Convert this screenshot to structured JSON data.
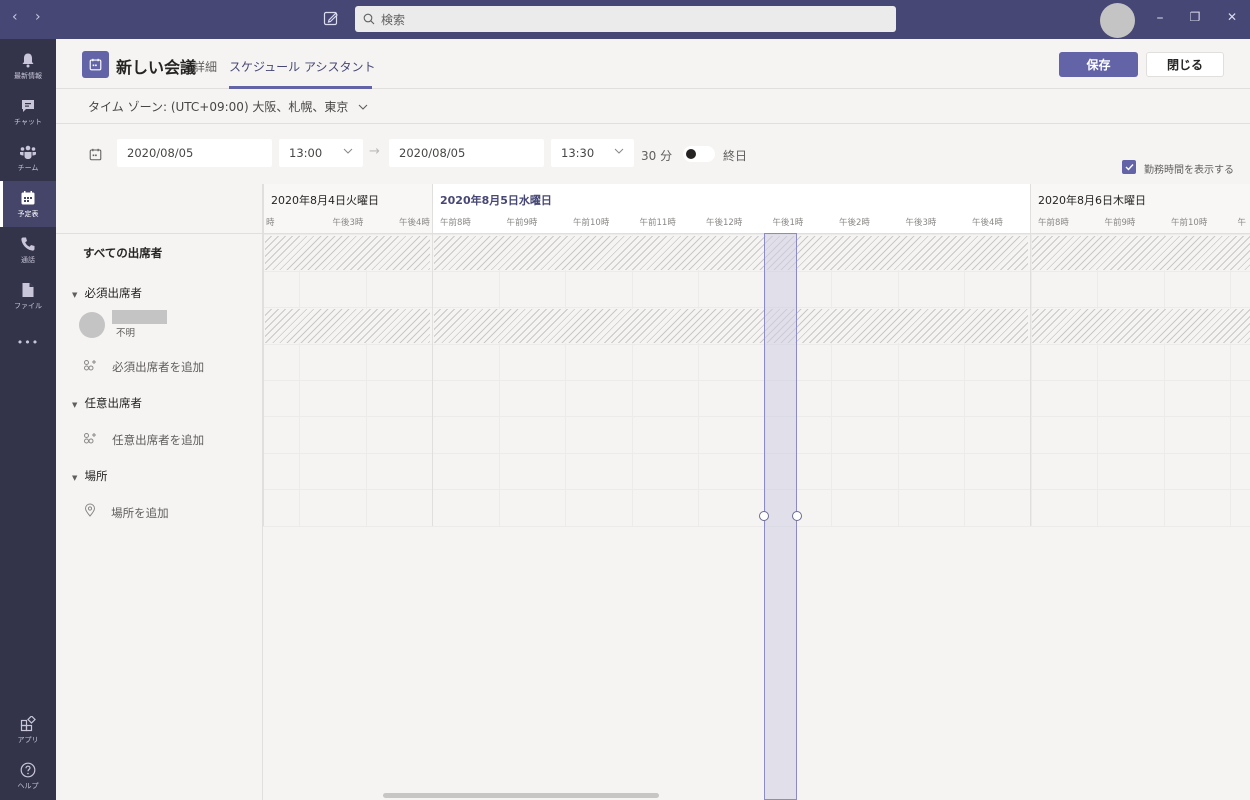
{
  "titlebar": {
    "back_icon": "chevron-left-icon",
    "forward_icon": "chevron-right-icon",
    "compose_icon": "compose-icon",
    "search_placeholder": "検索",
    "minimize": "–",
    "maximize": "❐",
    "close": "✕"
  },
  "rail": {
    "items": [
      {
        "label": "最新情報",
        "icon": "bell-icon"
      },
      {
        "label": "チャット",
        "icon": "chat-icon"
      },
      {
        "label": "チーム",
        "icon": "teams-icon"
      },
      {
        "label": "予定表",
        "icon": "calendar-icon",
        "active": true
      },
      {
        "label": "通話",
        "icon": "phone-icon"
      },
      {
        "label": "ファイル",
        "icon": "file-icon"
      },
      {
        "label": "•••",
        "icon": "more-icon"
      }
    ],
    "bottom": [
      {
        "label": "アプリ",
        "icon": "apps-icon"
      },
      {
        "label": "ヘルプ",
        "icon": "help-icon"
      }
    ]
  },
  "header": {
    "title": "新しい会議",
    "tabs": [
      {
        "label": "詳細"
      },
      {
        "label": "スケジュール アシスタント",
        "active": true
      }
    ],
    "save_label": "保存",
    "close_label": "閉じる"
  },
  "timezone": "タイム ゾーン: (UTC+09:00) 大阪、札幌、東京",
  "datetime": {
    "start_date": "2020/08/05",
    "start_time": "13:00",
    "end_date": "2020/08/05",
    "end_time": "13:30",
    "duration": "30 分",
    "all_day_label": "終日",
    "all_day": false,
    "working_hours_label": "勤務時間を表示する",
    "working_hours_checked": true
  },
  "left_panel": {
    "all_attendees": "すべての出席者",
    "required_section": "必須出席者",
    "attendee_status": "不明",
    "add_required": "必須出席者を追加",
    "optional_section": "任意出席者",
    "add_optional": "任意出席者を追加",
    "location_section": "場所",
    "add_location": "場所を追加"
  },
  "schedule": {
    "days": [
      {
        "title": "2020年8月4日火曜日",
        "hours": [
          "時",
          "午後3時",
          "午後4時"
        ]
      },
      {
        "title": "2020年8月5日水曜日",
        "today": true,
        "hours": [
          "午前8時",
          "午前9時",
          "午前10時",
          "午前11時",
          "午後12時",
          "午後1時",
          "午後2時",
          "午後3時",
          "午後4時"
        ]
      },
      {
        "title": "2020年8月6日木曜日",
        "hours": [
          "午前8時",
          "午前9時",
          "午前10時",
          "午"
        ]
      }
    ],
    "selected_slot": "午後1時 - 午後1時30分"
  },
  "colors": {
    "accent": "#6264a7",
    "titlebar": "#464775",
    "rail": "#33344a"
  }
}
